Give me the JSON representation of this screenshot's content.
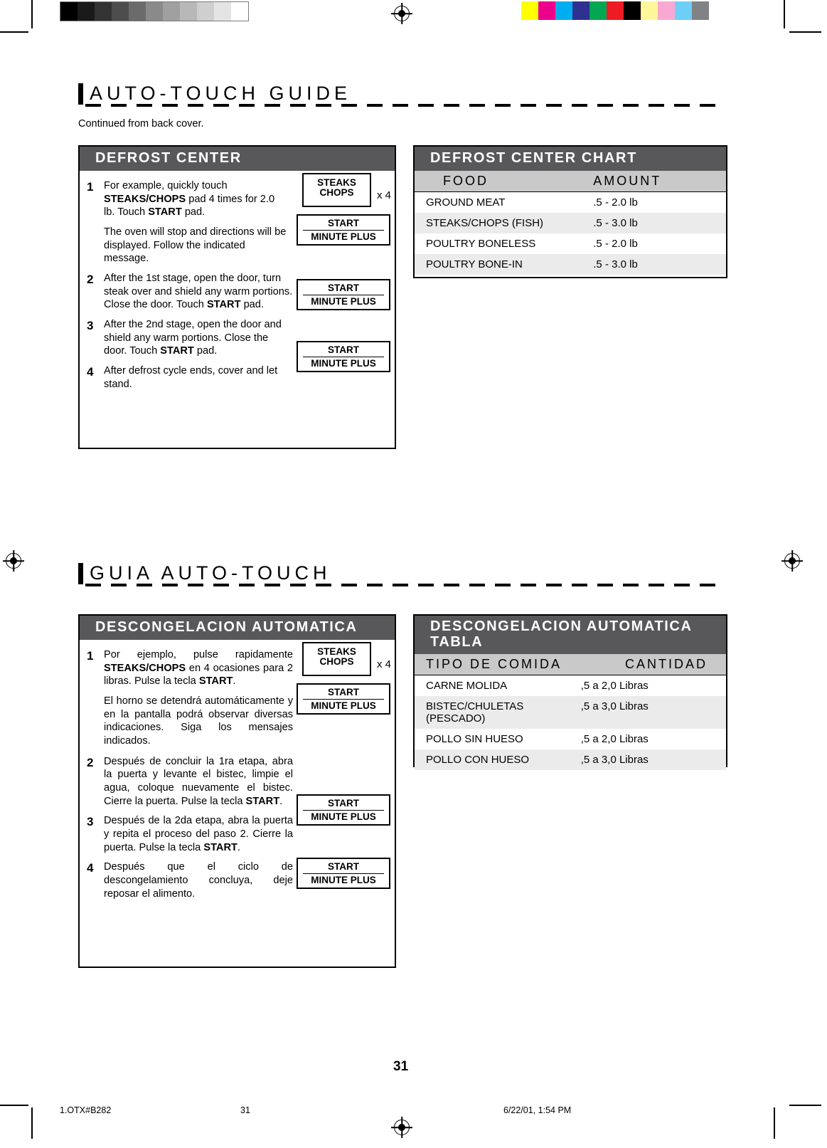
{
  "english": {
    "section_title": "AUTO-TOUCH GUIDE",
    "continued_note": "Continued from back cover.",
    "panel_title": "DEFROST CENTER",
    "steps": [
      {
        "num": "1",
        "paras": [
          "For example, quickly touch STEAKS/CHOPS pad 4 times for 2.0 lb. Touch START pad.",
          "The oven will stop and directions will be displayed. Follow the indicated message."
        ]
      },
      {
        "num": "2",
        "paras": [
          "After the 1st stage, open the door, turn steak over and shield any warm portions. Close the door. Touch START pad."
        ]
      },
      {
        "num": "3",
        "paras": [
          "After the 2nd stage, open the door and shield any warm portions. Close the door. Touch START pad."
        ]
      },
      {
        "num": "4",
        "paras": [
          "After defrost cycle ends, cover and let stand."
        ]
      }
    ],
    "pads": {
      "steaks_line1": "STEAKS",
      "steaks_line2": "CHOPS",
      "multiplier": "x 4",
      "start": "START",
      "minute_plus": "MINUTE PLUS"
    },
    "chart": {
      "title": "DEFROST CENTER CHART",
      "headers": [
        "FOOD",
        "AMOUNT"
      ],
      "rows": [
        [
          "GROUND MEAT",
          ".5 - 2.0 lb"
        ],
        [
          "STEAKS/CHOPS (FISH)",
          ".5 - 3.0 lb"
        ],
        [
          "POULTRY BONELESS",
          ".5 - 2.0 lb"
        ],
        [
          "POULTRY BONE-IN",
          ".5 - 3.0 lb"
        ]
      ]
    }
  },
  "spanish": {
    "section_title": "GUIA AUTO-TOUCH",
    "panel_title": "DESCONGELACION AUTOMATICA",
    "steps": [
      {
        "num": "1",
        "paras": [
          "Por ejemplo, pulse rapidamente STEAKS/CHOPS en 4 ocasiones para 2 libras. Pulse la tecla START.",
          "El horno se detendrá automáticamente y en la pantalla podrá observar diversas indicaciones. Siga los mensajes indicados."
        ]
      },
      {
        "num": "2",
        "paras": [
          "Después de concluir la 1ra etapa, abra la puerta y levante el bistec, limpie el agua, coloque nuevamente el bistec. Cierre la puerta. Pulse la tecla START."
        ]
      },
      {
        "num": "3",
        "paras": [
          "Después de la 2da etapa, abra la puerta y repita el proceso del paso 2. Cierre la puerta. Pulse la tecla START."
        ]
      },
      {
        "num": "4",
        "paras": [
          "Después que el ciclo de descongelamiento concluya, deje reposar el alimento."
        ]
      }
    ],
    "chart": {
      "title_line1": "DESCONGELACION AUTOMATICA",
      "title_line2": "TABLA",
      "headers": [
        "TIPO DE COMIDA",
        "CANTIDAD"
      ],
      "rows": [
        [
          "CARNE MOLIDA",
          ",5 a 2,0 Libras"
        ],
        [
          "BISTEC/CHULETAS (PESCADO)",
          ",5 a 3,0 Libras"
        ],
        [
          "POLLO SIN HUESO",
          ",5 a 2,0 Libras"
        ],
        [
          "POLLO CON HUESO",
          ",5 a 3,0 Libras"
        ]
      ]
    }
  },
  "footer": {
    "page_number": "31",
    "file_label": "1.OTX#B282",
    "sheet_number": "31",
    "timestamp": "6/22/01, 1:54 PM"
  },
  "colorbars": {
    "grayscale": [
      "#000000",
      "#1a1a1a",
      "#333333",
      "#4d4d4d",
      "#666666",
      "#808080",
      "#999999",
      "#b3b3b3",
      "#cccccc",
      "#e6e6e6",
      "#ffffff"
    ],
    "colors": [
      "#ffff00",
      "#ec008c",
      "#00aeef",
      "#2e3192",
      "#00a651",
      "#ed1c24",
      "#000000",
      "#fff799",
      "#f9a8d4",
      "#6dcff6",
      "#808285"
    ]
  }
}
